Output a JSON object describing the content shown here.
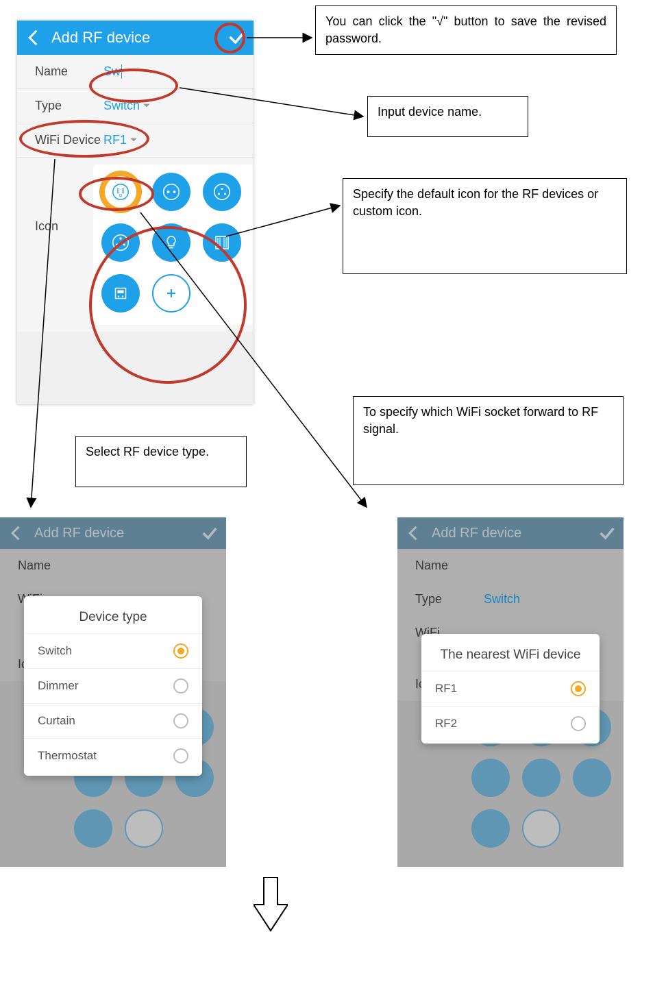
{
  "main_phone": {
    "header_title": "Add RF device",
    "rows": {
      "name_label": "Name",
      "name_value": "Sw",
      "type_label": "Type",
      "type_value": "Switch",
      "wifi_label": "WiFi Device",
      "wifi_value": "RF1",
      "icon_label": "Icon"
    }
  },
  "callouts": {
    "save": "You can click the \"√\" button to save the revised password.",
    "name": "Input device name.",
    "icon": "Specify the default icon for the RF devices or custom icon.",
    "type": "Select RF device type.",
    "wifi": "To specify which WiFi socket forward to RF signal."
  },
  "dialog_type": {
    "title": "Device type",
    "opts": [
      "Switch",
      "Dimmer",
      "Curtain",
      "Thermostat"
    ]
  },
  "dialog_wifi": {
    "title": "The nearest WiFi device",
    "opts": [
      "RF1",
      "RF2"
    ]
  },
  "small_header": "Add RF device",
  "small_name_label": "Name",
  "small_type_label": "Type",
  "small_type_value": "Switch",
  "small_wifi_label": "WiFi",
  "small_icon_label": "Icon"
}
